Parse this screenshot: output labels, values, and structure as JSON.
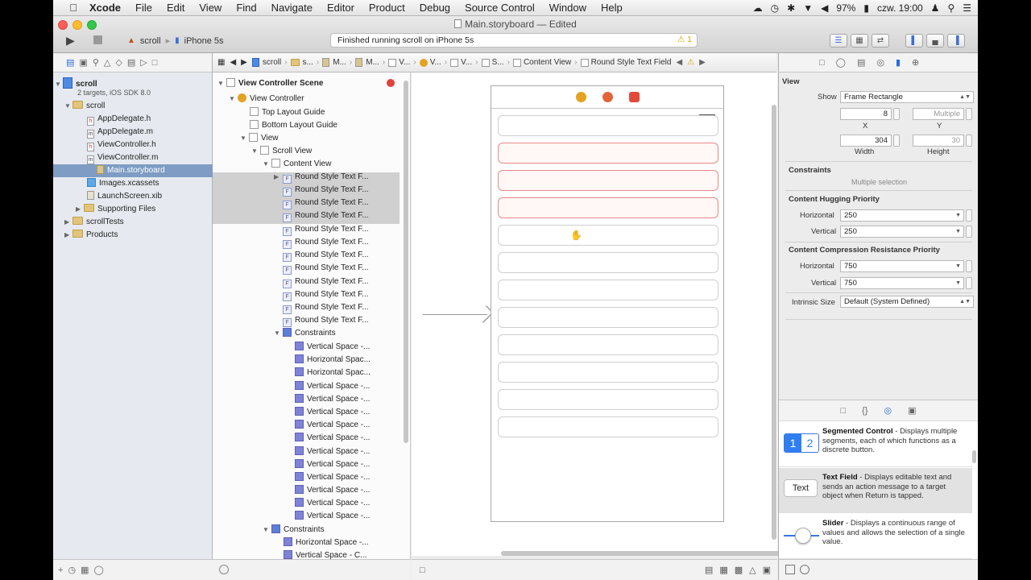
{
  "menubar": {
    "app": "Xcode",
    "items": [
      "File",
      "Edit",
      "View",
      "Find",
      "Navigate",
      "Editor",
      "Product",
      "Debug",
      "Source Control",
      "Window",
      "Help"
    ],
    "battery": "97%",
    "clock": "czw. 19:00"
  },
  "toolbar": {
    "window_title": "Main.storyboard — Edited",
    "scheme": "scroll",
    "device": "iPhone 5s",
    "activity": "Finished running scroll on iPhone 5s",
    "warning_count": "1"
  },
  "navigator": {
    "project": "scroll",
    "project_sub": "2 targets, iOS SDK 8.0",
    "group": "scroll",
    "files": [
      "AppDelegate.h",
      "AppDelegate.m",
      "ViewController.h",
      "ViewController.m",
      "Main.storyboard",
      "Images.xcassets",
      "LaunchScreen.xib",
      "Supporting Files"
    ],
    "other_groups": [
      "scrollTests",
      "Products"
    ]
  },
  "jumpbar": {
    "segments": [
      "scroll",
      "s...",
      "M...",
      "M...",
      "V...",
      "V...",
      "V...",
      "S...",
      "Content View",
      "Round Style Text Field"
    ]
  },
  "outline": {
    "scene": "View Controller Scene",
    "vc": "View Controller",
    "top_guide": "Top Layout Guide",
    "bottom_guide": "Bottom Layout Guide",
    "view": "View",
    "scroll_view": "Scroll View",
    "content_view": "Content View",
    "text_field": "Round Style Text F...",
    "constraints": "Constraints",
    "constraint_items": [
      "Vertical Space -...",
      "Horizontal Spac...",
      "Horizontal Spac...",
      "Vertical Space -...",
      "Vertical Space -...",
      "Vertical Space -...",
      "Vertical Space -...",
      "Vertical Space -...",
      "Vertical Space -...",
      "Vertical Space -...",
      "Vertical Space -...",
      "Vertical Space -...",
      "Vertical Space -...",
      "Vertical Space -..."
    ],
    "constraints2": "Constraints",
    "constraint_items2": [
      "Horizontal Space -...",
      "Vertical Space - C..."
    ]
  },
  "inspector": {
    "section_view": "View",
    "show_label": "Show",
    "show_value": "Frame Rectangle",
    "x_value": "8",
    "y_value": "Multiple",
    "x_label": "X",
    "y_label": "Y",
    "width_value": "304",
    "height_value": "30",
    "width_label": "Width",
    "height_label": "Height",
    "constraints_title": "Constraints",
    "constraints_note": "Multiple selection",
    "hugging_title": "Content Hugging Priority",
    "horizontal_label": "Horizontal",
    "vertical_label": "Vertical",
    "hug_h": "250",
    "hug_v": "250",
    "compression_title": "Content Compression Resistance Priority",
    "comp_h": "750",
    "comp_v": "750",
    "intrinsic_label": "Intrinsic Size",
    "intrinsic_value": "Default (System Defined)"
  },
  "library": {
    "items": [
      {
        "title": "Segmented Control",
        "desc": " - Displays multiple segments, each of which functions as a discrete button.",
        "seg1": "1",
        "seg2": "2"
      },
      {
        "title": "Text Field",
        "desc": " - Displays editable text and sends an action message to a target object when Return is tapped.",
        "thumb": "Text"
      },
      {
        "title": "Slider",
        "desc": " - Displays a continuous range of values and allows the selection of a single value."
      }
    ]
  },
  "colors": {
    "accent": "#2d6ed9",
    "selection": "#7e9cc4",
    "constraint": "#7f83d6"
  }
}
